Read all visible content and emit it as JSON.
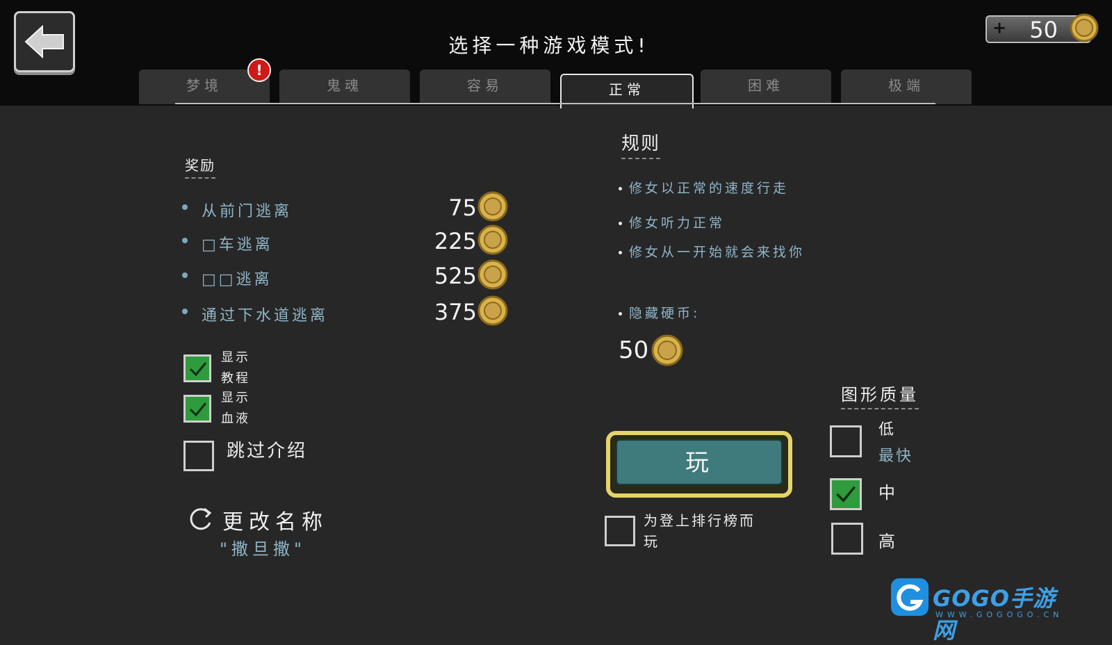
{
  "header": {
    "title": "选择一种游戏模式!",
    "coins": "50",
    "plus": "+"
  },
  "tabs": [
    {
      "label": "梦境",
      "active": false
    },
    {
      "label": "鬼魂",
      "active": false
    },
    {
      "label": "容易",
      "active": false
    },
    {
      "label": "正常",
      "active": true
    },
    {
      "label": "困难",
      "active": false
    },
    {
      "label": "极端",
      "active": false
    }
  ],
  "alert_badge": "!",
  "rewards": {
    "heading": "奖励",
    "items": [
      {
        "label": "从前门逃离",
        "value": "75"
      },
      {
        "label": "□车逃离",
        "value": "225"
      },
      {
        "label": "□□逃离",
        "value": "525"
      },
      {
        "label": "通过下水道逃离",
        "value": "375"
      }
    ]
  },
  "rules": {
    "heading": "规则",
    "items": [
      "修女以正常的速度行走",
      "修女听力正常",
      "修女从一开始就会来找你"
    ],
    "hidden_coins_label": "隐藏硬币:",
    "hidden_coins_value": "50"
  },
  "options": {
    "show_tutorial": {
      "line1": "显示",
      "line2": "教程",
      "checked": true
    },
    "show_blood": {
      "line1": "显示",
      "line2": "血液",
      "checked": true
    },
    "skip_intro": {
      "label": "跳过介绍",
      "checked": false
    }
  },
  "rename": {
    "label": "更改名称",
    "name": "\"撒旦撒\""
  },
  "play": {
    "label": "玩",
    "leaderboard_line1": "为登上排行榜而",
    "leaderboard_line2": "玩",
    "leaderboard_checked": false
  },
  "graphics": {
    "heading": "图形质量",
    "options": [
      {
        "label": "低",
        "sub": "最快",
        "checked": false
      },
      {
        "label": "中",
        "sub": "",
        "checked": true
      },
      {
        "label": "高",
        "sub": "",
        "checked": false
      }
    ]
  },
  "watermark": {
    "brand": "GOGO手游网",
    "url": "WWW.GOGOGO.CN"
  },
  "colors": {
    "accent_green": "#2f9b3c",
    "play_button": "#3f7a7d",
    "play_border": "#e5d46a",
    "coin": "#d9b24a"
  }
}
